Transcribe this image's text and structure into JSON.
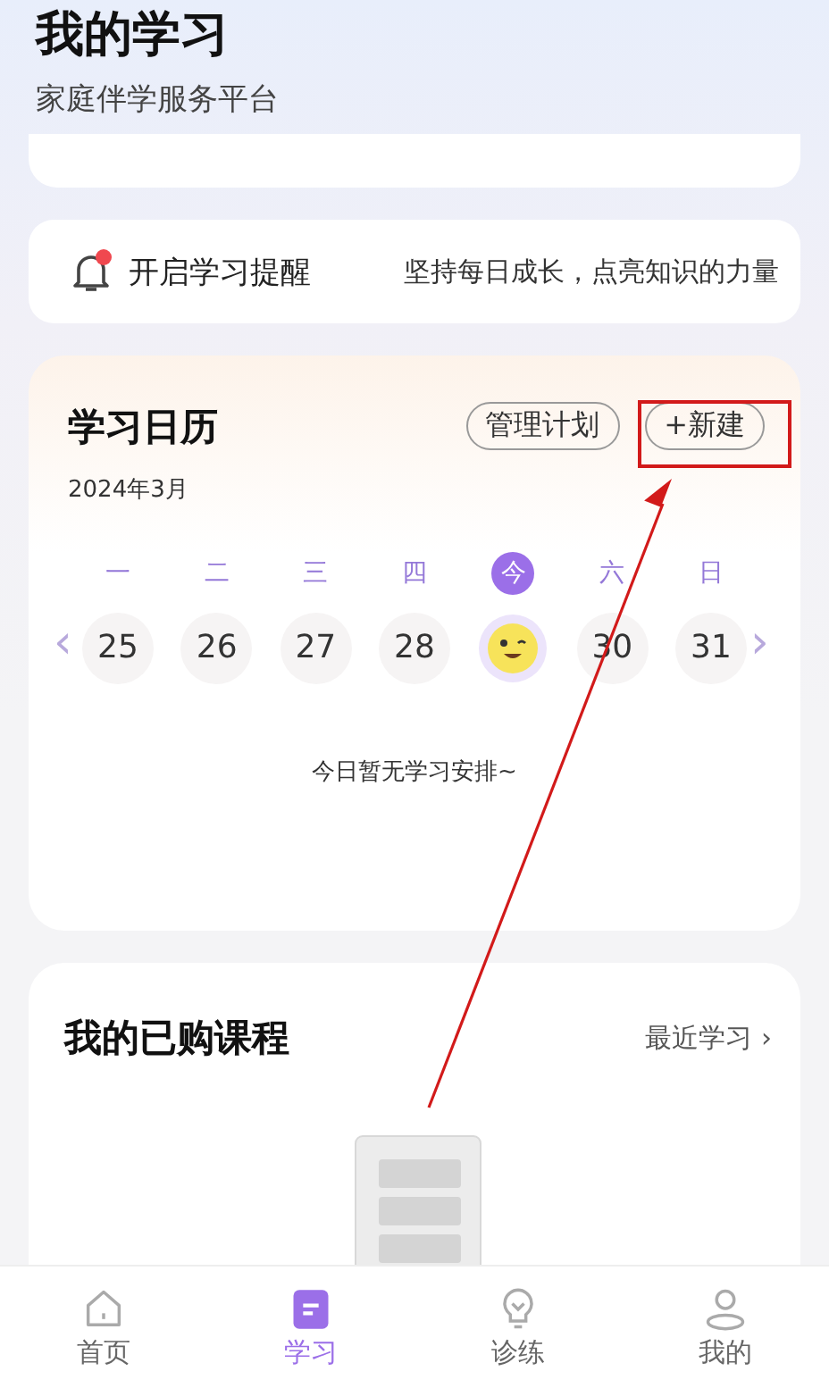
{
  "header": {
    "title": "我的学习",
    "subtitle": "家庭伴学服务平台"
  },
  "reminder": {
    "label": "开启学习提醒",
    "unread": true,
    "slogan": "坚持每日成长，点亮知识的力量"
  },
  "calendar": {
    "title": "学习日历",
    "month": "2024年3月",
    "buttons": [
      "管理计划",
      "+新建"
    ],
    "empty_text": "今日暂无学习安排~",
    "prev": "‹",
    "next": "›",
    "days": [
      {
        "weekday": "一",
        "date": "25",
        "today": false
      },
      {
        "weekday": "二",
        "date": "26",
        "today": false
      },
      {
        "weekday": "三",
        "date": "27",
        "today": false
      },
      {
        "weekday": "四",
        "date": "28",
        "today": false
      },
      {
        "weekday": "今",
        "today": true
      },
      {
        "weekday": "六",
        "date": "30",
        "today": false
      },
      {
        "weekday": "日",
        "date": "31",
        "today": false
      }
    ]
  },
  "courses": {
    "title": "我的已购课程",
    "link": "最近学习",
    "link_arrow": "›"
  },
  "tab_bar": [
    {
      "label": "首页",
      "selected": false
    },
    {
      "label": "学习",
      "selected": true
    },
    {
      "label": "诊练",
      "selected": false
    },
    {
      "label": "我的",
      "selected": false
    }
  ]
}
